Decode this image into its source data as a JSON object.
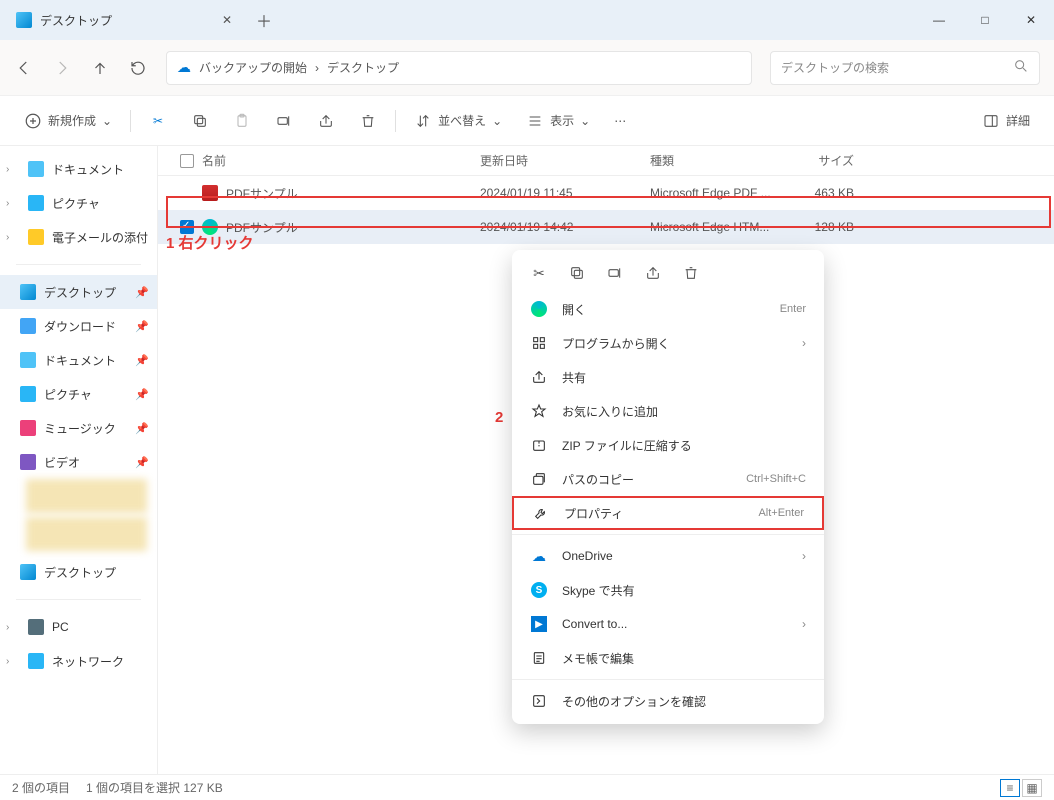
{
  "window": {
    "title": "デスクトップ"
  },
  "nav": {
    "backup": "バックアップの開始",
    "current": "デスクトップ",
    "search_placeholder": "デスクトップの検索"
  },
  "toolbar": {
    "new": "新規作成",
    "sort": "並べ替え",
    "view": "表示",
    "details": "詳細"
  },
  "columns": {
    "name": "名前",
    "date": "更新日時",
    "type": "種類",
    "size": "サイズ"
  },
  "rows": [
    {
      "name": "PDFサンプル",
      "date": "2024/01/19 11:45",
      "type": "Microsoft Edge PDF ...",
      "size": "463 KB"
    },
    {
      "name": "PDFサンプル",
      "date": "2024/01/19 14:42",
      "type": "Microsoft Edge HTM...",
      "size": "128 KB"
    }
  ],
  "annotations": {
    "one": "1 右クリック",
    "two": "2"
  },
  "sidebar": {
    "top": [
      {
        "label": "ドキュメント"
      },
      {
        "label": "ピクチャ"
      },
      {
        "label": "電子メールの添付"
      }
    ],
    "quick": [
      {
        "label": "デスクトップ"
      },
      {
        "label": "ダウンロード"
      },
      {
        "label": "ドキュメント"
      },
      {
        "label": "ピクチャ"
      },
      {
        "label": "ミュージック"
      },
      {
        "label": "ビデオ"
      }
    ],
    "desktop": "デスクトップ",
    "pc": "PC",
    "network": "ネットワーク"
  },
  "context_menu": [
    {
      "icon": "edge",
      "label": "開く",
      "shortcut": "Enter"
    },
    {
      "icon": "app",
      "label": "プログラムから開く",
      "chev": true
    },
    {
      "icon": "share",
      "label": "共有"
    },
    {
      "icon": "star",
      "label": "お気に入りに追加"
    },
    {
      "icon": "zip",
      "label": "ZIP ファイルに圧縮する"
    },
    {
      "icon": "copy",
      "label": "パスのコピー",
      "shortcut": "Ctrl+Shift+C"
    },
    {
      "icon": "wrench",
      "label": "プロパティ",
      "shortcut": "Alt+Enter",
      "highlight": true
    },
    {
      "sep": true
    },
    {
      "icon": "onedrive",
      "label": "OneDrive",
      "chev": true
    },
    {
      "icon": "skype",
      "label": "Skype で共有"
    },
    {
      "icon": "convert",
      "label": "Convert to...",
      "chev": true
    },
    {
      "icon": "notepad",
      "label": "メモ帳で編集"
    },
    {
      "sep": true
    },
    {
      "icon": "more",
      "label": "その他のオプションを確認"
    }
  ],
  "status": {
    "count": "2 個の項目",
    "selected": "1 個の項目を選択  127 KB"
  }
}
